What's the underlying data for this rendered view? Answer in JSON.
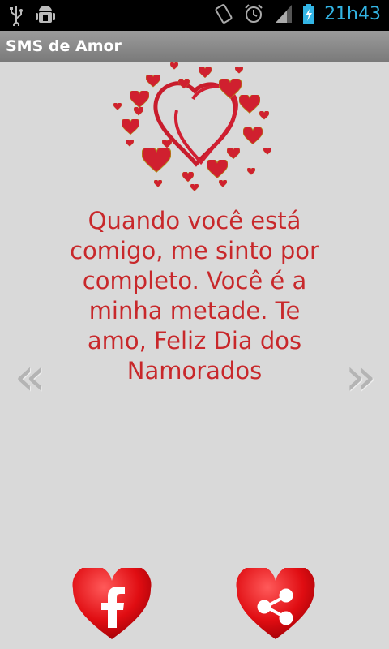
{
  "status_bar": {
    "time": "21h43",
    "accent_color": "#33b5e5",
    "icons": [
      "usb-icon",
      "android-debug-icon",
      "vibrate-icon",
      "alarm-icon",
      "signal-icon",
      "battery-charging-icon"
    ]
  },
  "app": {
    "title": "SMS de Amor"
  },
  "message": {
    "text": "Quando você está comigo, me sinto por completo. Você é a minha metade. Te amo, Feliz Dia dos Namorados",
    "color": "#c8282b"
  },
  "nav": {
    "prev_glyph": "«",
    "next_glyph": "»"
  },
  "buttons": {
    "facebook_icon": "facebook-heart-icon",
    "share_icon": "share-heart-icon"
  }
}
